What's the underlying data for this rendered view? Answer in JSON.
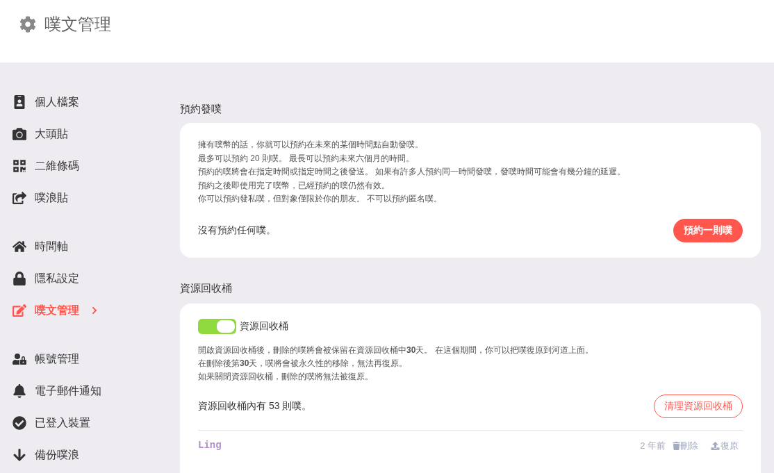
{
  "header": {
    "title": "噗文管理"
  },
  "sidebar": {
    "groups": [
      [
        {
          "label": "個人檔案",
          "selected": false
        },
        {
          "label": "大頭貼",
          "selected": false
        },
        {
          "label": "二維條碼",
          "selected": false
        },
        {
          "label": "噗浪貼",
          "selected": false
        }
      ],
      [
        {
          "label": "時間軸",
          "selected": false
        },
        {
          "label": "隱私設定",
          "selected": false
        },
        {
          "label": "噗文管理",
          "selected": true
        }
      ],
      [
        {
          "label": "帳號管理",
          "selected": false
        },
        {
          "label": "電子郵件通知",
          "selected": false
        },
        {
          "label": "已登入裝置",
          "selected": false
        },
        {
          "label": "備份噗浪",
          "selected": false
        }
      ]
    ]
  },
  "scheduled": {
    "title": "預約發噗",
    "lines": [
      "擁有噗幣的話，你就可以預約在未來的某個時間點自動發噗。",
      "最多可以預約 20 則噗。 最長可以預約未來六個月的時間。",
      "預約的噗將會在指定時間或指定時間之後發送。 如果有許多人預約同一時間發噗，發噗時間可能會有幾分鐘的延遲。",
      "預約之後即使用完了噗幣，已經預約的噗仍然有效。",
      "你可以預約發私噗，但對象僅限於你的朋友。 不可以預約匿名噗。"
    ],
    "status": "沒有預約任何噗。",
    "button": "預約一則噗"
  },
  "recycle": {
    "title": "資源回收桶",
    "toggle": {
      "label": "資源回收桶",
      "on": true
    },
    "lines": [
      "開啟資源回收桶後，刪除的噗將會被保留在資源回收桶中**30**天。 在這個期間，你可以把噗復原到河道上面。",
      "在刪除後第**30**天，噗將會被永久性的移除，無法再復原。",
      "如果關閉資源回收桶，刪除的噗將無法被復原。"
    ],
    "status": "資源回收桶內有 53 則噗。",
    "button": "清理資源回收桶",
    "items": [
      {
        "author": "Ling",
        "time": "2 年前",
        "delete": "刪除",
        "restore": "復原"
      }
    ]
  }
}
